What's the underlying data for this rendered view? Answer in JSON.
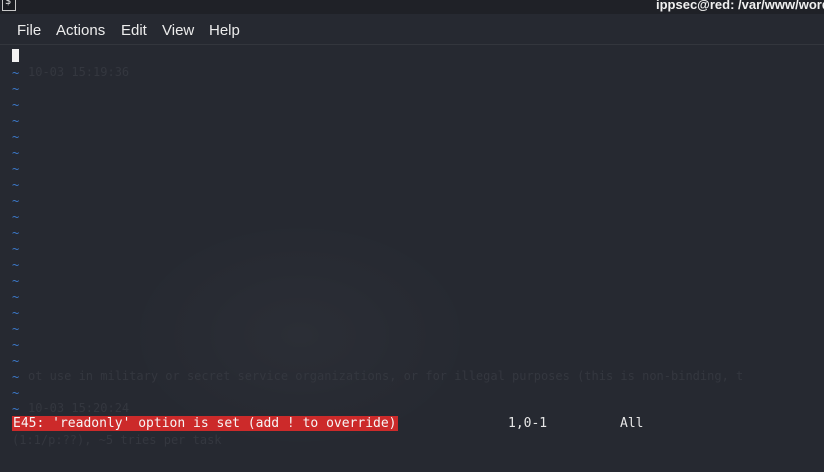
{
  "window": {
    "title": "ippsec@red: /var/www/wordp"
  },
  "menu": [
    "File",
    "Actions",
    "Edit",
    "View",
    "Help"
  ],
  "editor": {
    "empty_line_marker": "~",
    "background_ghost_text": [
      "10-03 15:19:36",
      "ot use in military or secret service organizations, or for illegal purposes (this is non-binding, t",
      "10-03 15:20:24",
      "(1:1/p:??), ~5 tries per task"
    ]
  },
  "status_line": {
    "error": "E45: 'readonly' option is set (add ! to override)",
    "position": "1,0-1",
    "scroll": "All"
  },
  "colors": {
    "background": "#262931",
    "tilde": "#3b78c8",
    "error_bg": "#cc2a2a"
  }
}
